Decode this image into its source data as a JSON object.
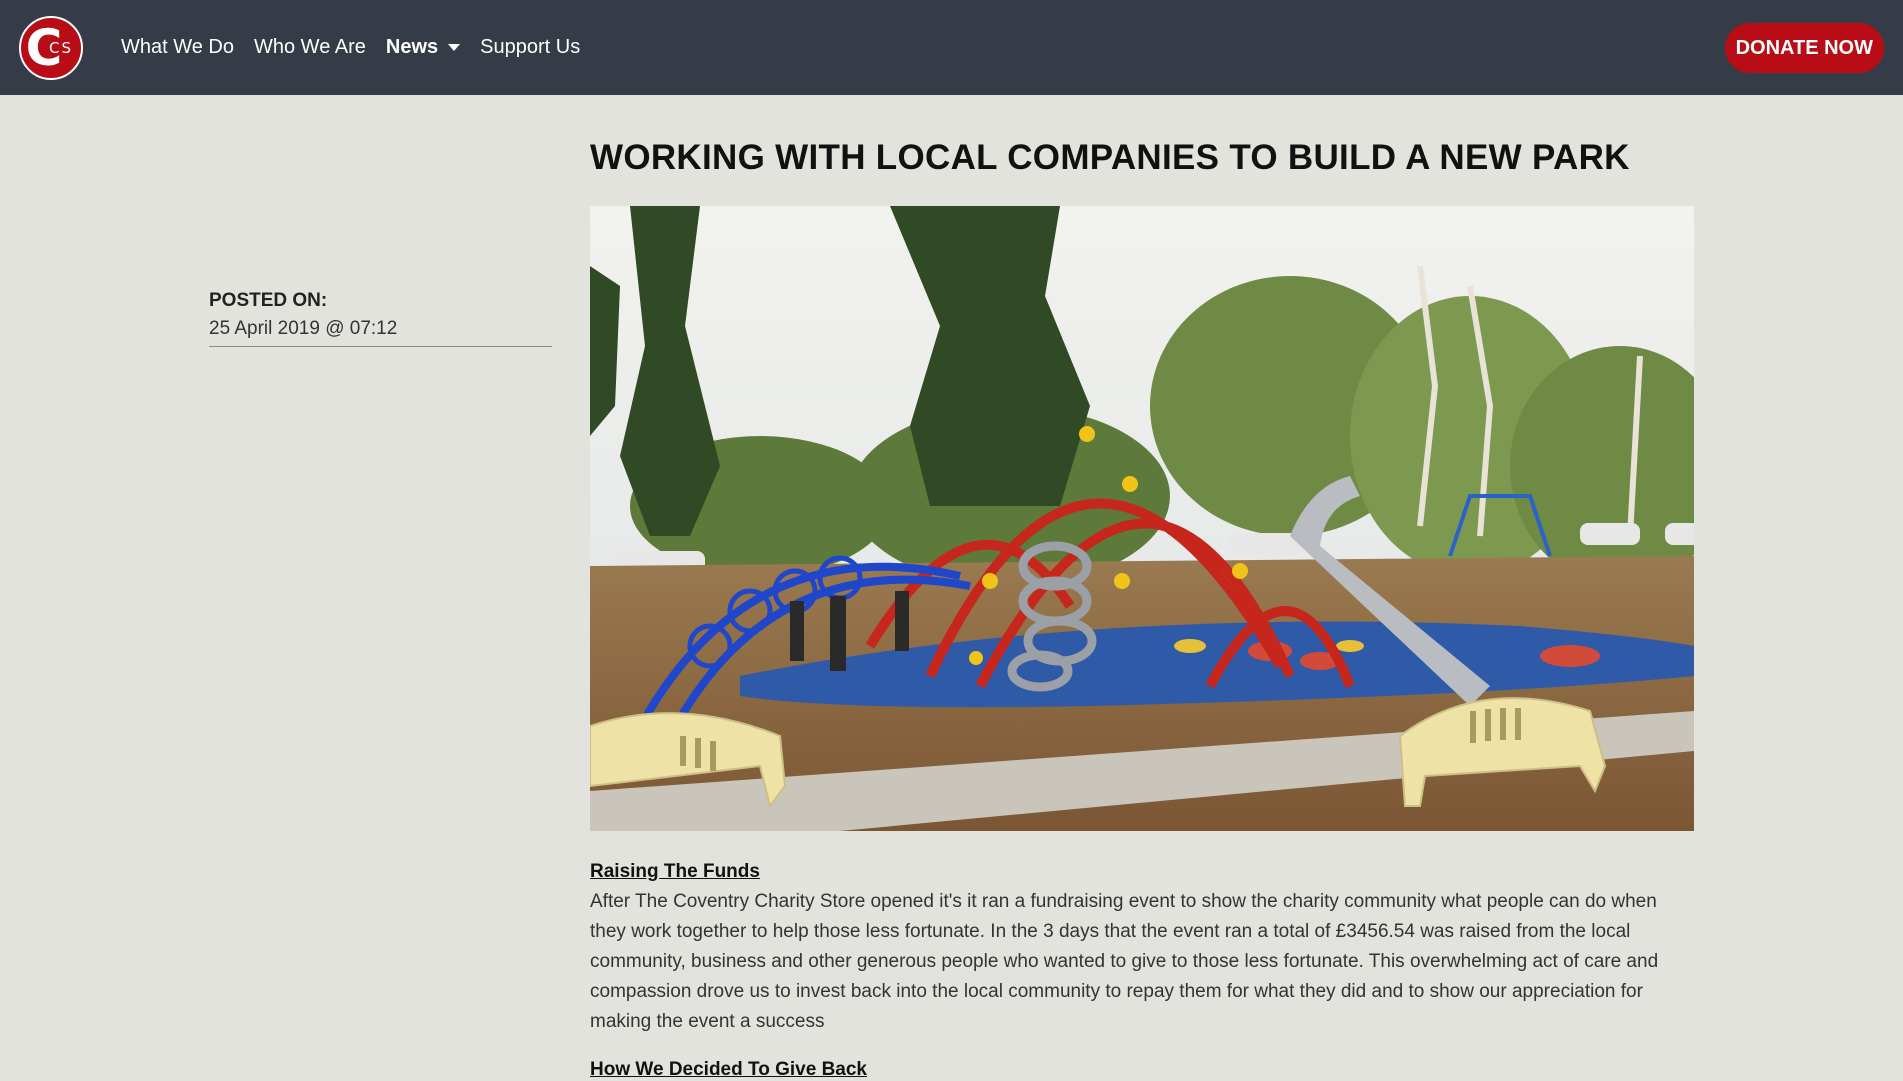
{
  "nav": {
    "logo_text_big": "C",
    "logo_text_small": "CS",
    "items": [
      {
        "label": "What We Do"
      },
      {
        "label": "Who We Are"
      },
      {
        "label": "News"
      },
      {
        "label": "Support Us"
      }
    ],
    "donate_label": "DONATE NOW"
  },
  "meta": {
    "posted_label": "POSTED ON:",
    "posted_date": "25 April 2019 @ 07:12"
  },
  "article": {
    "title": "WORKING WITH LOCAL COMPANIES TO BUILD A NEW PARK",
    "sections": [
      {
        "heading": "Raising The Funds",
        "body": "After The Coventry Charity Store opened it's it ran a fundraising event to show the charity community what people can do when they work together to help those less fortunate. In the 3 days that the event ran a total of £3456.54 was raised from the local community, business and other generous people who wanted to give to those less fortunate. This overwhelming act of care and compassion drove us to invest back into the local community to repay them for what they did and to show our appreciation for making the event a success"
      },
      {
        "heading": "How We Decided To Give Back"
      }
    ]
  },
  "colors": {
    "navbar": "#363c47",
    "brand_red": "#b80d16",
    "page_bg": "#e3e3de"
  }
}
